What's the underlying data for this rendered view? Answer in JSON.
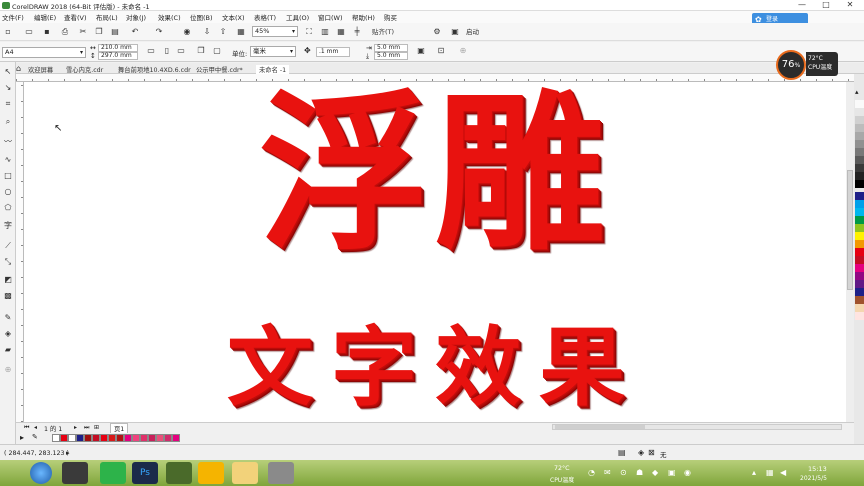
{
  "window": {
    "title": "CorelDRAW 2018 (64-Bit 评估版) - 未命名 -1",
    "minimize": "—",
    "maximize": "□",
    "close": "✕"
  },
  "menu": [
    "文件(F)",
    "编辑(E)",
    "查看(V)",
    "布局(L)",
    "对象(J)",
    "效果(C)",
    "位图(B)",
    "文本(X)",
    "表格(T)",
    "工具(O)",
    "窗口(W)",
    "帮助(H)",
    "购买"
  ],
  "login_label": "登录",
  "toolbar": {
    "zoom": "45%",
    "snap": "贴齐(T)",
    "launch": "启动"
  },
  "property_bar": {
    "page_size": "A4",
    "width": "210.0 mm",
    "height": "297.0 mm",
    "units_label": "单位:",
    "units": "毫米",
    "nudge": ".1 mm",
    "dup_x": "5.0 mm",
    "dup_y": "5.0 mm"
  },
  "tabs": [
    "欢迎屏幕",
    "雪心内克.cdr",
    "舞台前项地10.4XD.6.cdr",
    "公示甲中餐.cdr*",
    "未命名 -1"
  ],
  "canvas": {
    "title_large": "浮雕",
    "subtitle": "文字效果"
  },
  "page_nav": {
    "page_count": "1 的 1",
    "page_tab": "页1"
  },
  "status": {
    "coords": "( 284.447, 283.123 )",
    "fill_none": "无"
  },
  "cpu_widget": {
    "percent": "76",
    "unit": "%",
    "temp": "72°C",
    "label": "CPU温度"
  },
  "tray": {
    "temp": "72°C",
    "label": "CPU温度",
    "time": "15:13",
    "date": "2021/5/5"
  },
  "colors": {
    "text_red": "#e8120f",
    "palette": [
      "#ffffff",
      "#000000",
      "#00a0e9",
      "#1d2088",
      "#e4007f",
      "#e60012",
      "#fff100",
      "#009944",
      "#f39800",
      "#920783",
      "#8fc31f",
      "#00b7ee",
      "#c30d23",
      "#cccccc"
    ]
  }
}
